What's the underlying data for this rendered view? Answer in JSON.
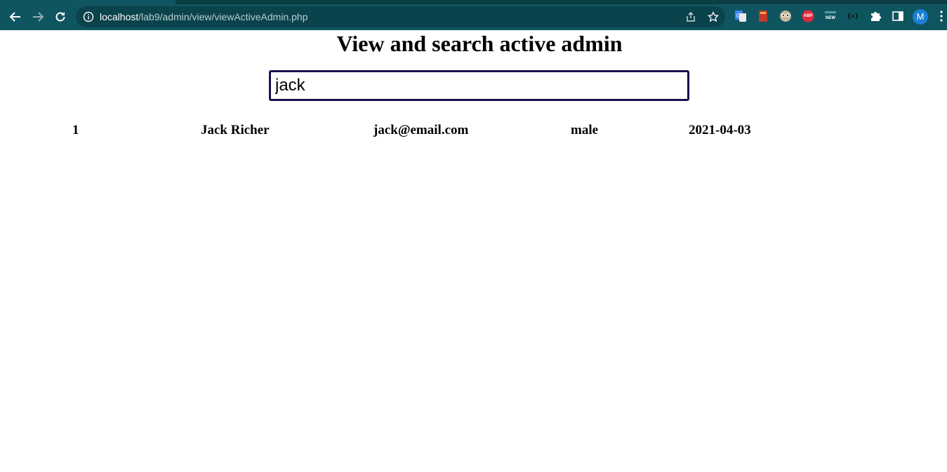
{
  "browser": {
    "url_host": "localhost",
    "url_path": "/lab9/admin/view/viewActiveAdmin.php",
    "profile_initial": "M",
    "extensions": [
      {
        "name": "google-translate-icon"
      },
      {
        "name": "bookmark-book-icon"
      },
      {
        "name": "owl-eyes-icon"
      },
      {
        "name": "adblock-plus-icon",
        "label": "ABP"
      },
      {
        "name": "new-badge-icon",
        "label": "NEW"
      },
      {
        "name": "broadcast-icon"
      },
      {
        "name": "puzzle-extensions-icon"
      },
      {
        "name": "side-panel-icon"
      }
    ],
    "colors": {
      "toolbar": "#0f5560",
      "omnibox": "#0a434b"
    }
  },
  "page": {
    "title": "View and search active admin",
    "search": {
      "value": "jack"
    },
    "results": [
      {
        "id": "1",
        "name": "Jack Richer",
        "email": "jack@email.com",
        "gender": "male",
        "date": "2021-04-03"
      }
    ]
  }
}
